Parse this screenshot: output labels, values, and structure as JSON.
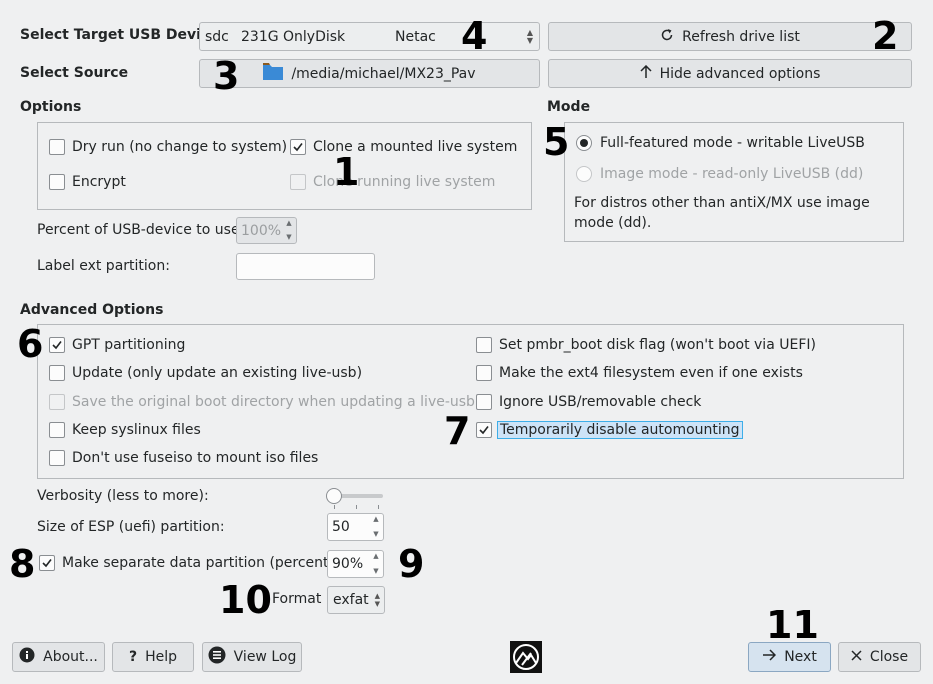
{
  "target": {
    "label": "Select Target USB Device",
    "device": "sdc",
    "size": "231G OnlyDisk",
    "vendor": "Netac"
  },
  "refresh_button": "Refresh drive list",
  "source": {
    "label": "Select Source",
    "path": "/media/michael/MX23_Pav"
  },
  "hide_advanced_button": "Hide advanced options",
  "options": {
    "title": "Options",
    "dry_run": {
      "label": "Dry run (no change to system)",
      "checked": false
    },
    "clone_mounted": {
      "label": "Clone a mounted live system",
      "checked": true
    },
    "encrypt": {
      "label": "Encrypt",
      "checked": false
    },
    "clone_running": {
      "label": "Clone running live system",
      "checked": false,
      "disabled": true
    },
    "percent_label": "Percent of USB-device to use:",
    "percent_value": "100%",
    "label_ext_label": "Label ext partition:",
    "label_ext_value": ""
  },
  "mode": {
    "title": "Mode",
    "full_featured": "Full-featured mode - writable LiveUSB",
    "image_mode": "Image mode - read-only LiveUSB (dd)",
    "note": "For distros other than antiX/MX use image mode (dd).",
    "selected": "full_featured"
  },
  "advanced": {
    "title": "Advanced Options",
    "gpt": {
      "label": "GPT partitioning",
      "checked": true
    },
    "update": {
      "label": "Update (only update an existing live-usb)",
      "checked": false
    },
    "save_boot": {
      "label": "Save the original boot directory when updating a live-usb",
      "checked": false,
      "disabled": true
    },
    "keep_syslinux": {
      "label": "Keep syslinux files",
      "checked": false
    },
    "no_fuseiso": {
      "label": "Don't use fuseiso to mount iso files",
      "checked": false
    },
    "pmbr": {
      "label": "Set pmbr_boot disk flag (won't boot via UEFI)",
      "checked": false
    },
    "ext4": {
      "label": "Make the ext4 filesystem even if one exists",
      "checked": false
    },
    "ignore_usb": {
      "label": "Ignore USB/removable check",
      "checked": false
    },
    "disable_automount": {
      "label": "Temporarily disable automounting",
      "checked": true
    }
  },
  "verbosity_label": "Verbosity (less to more):",
  "verbosity_level": 0,
  "esp_label": "Size of ESP (uefi) partition:",
  "esp_value": "50",
  "data_partition": {
    "label": "Make separate data partition (percent)",
    "checked": true,
    "value": "90%"
  },
  "format": {
    "label": "Format",
    "value": "exfat"
  },
  "buttons": {
    "about": "About...",
    "help": "Help",
    "view_log": "View Log",
    "next": "Next",
    "close": "Close"
  },
  "annotations": [
    "1",
    "2",
    "3",
    "4",
    "5",
    "6",
    "7",
    "8",
    "9",
    "10",
    "11"
  ]
}
